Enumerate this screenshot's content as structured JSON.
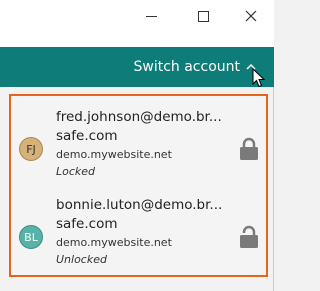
{
  "window": {
    "minimize_label": "minimize",
    "maximize_label": "maximize",
    "close_label": "close"
  },
  "header": {
    "switch_account_label": "Switch account"
  },
  "accounts": [
    {
      "initials": "FJ",
      "email_line1": "fred.johnson@demo.br...",
      "email_line2": "safe.com",
      "site": "demo.mywebsite.net",
      "status": "Locked",
      "lock_icon": "lock-closed-icon",
      "avatar_color": "#d6b27a"
    },
    {
      "initials": "BL",
      "email_line1": "bonnie.luton@demo.br...",
      "email_line2": "safe.com",
      "site": "demo.mywebsite.net",
      "status": "Unlocked",
      "lock_icon": "lock-open-icon",
      "avatar_color": "#57b3a6"
    }
  ],
  "colors": {
    "appbar": "#0e7c78",
    "highlight_border": "#e8641c"
  }
}
